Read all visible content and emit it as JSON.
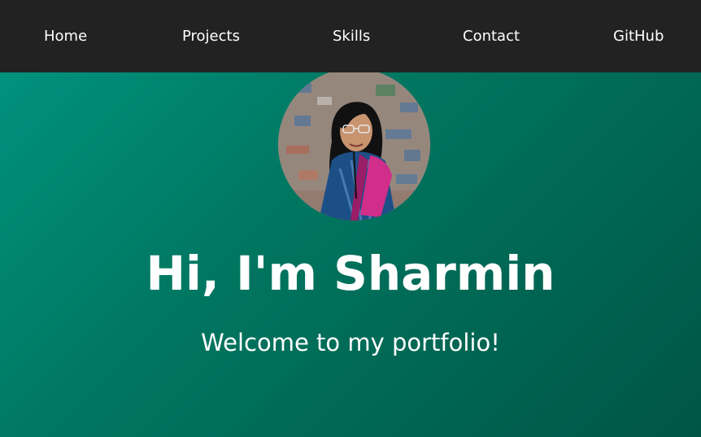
{
  "nav": {
    "items": [
      {
        "label": "Home"
      },
      {
        "label": "Projects"
      },
      {
        "label": "Skills"
      },
      {
        "label": "Contact"
      },
      {
        "label": "GitHub"
      }
    ]
  },
  "hero": {
    "title": "Hi, I'm Sharmin",
    "subtitle": "Welcome to my portfolio!"
  },
  "colors": {
    "navbar_background": "#222222",
    "hero_gradient_start": "#009682",
    "hero_gradient_end": "#005546",
    "text": "#ffffff"
  }
}
